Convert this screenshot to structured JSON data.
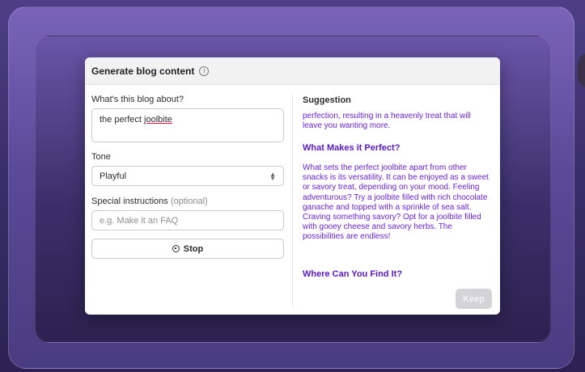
{
  "modal": {
    "title": "Generate blog content",
    "info_icon": "info-icon"
  },
  "form": {
    "topic_label": "What's this blog about?",
    "topic_value_plain": "the perfect ",
    "topic_value_underlined": "joolbite",
    "tone_label": "Tone",
    "tone_value": "Playful",
    "instructions_label": "Special instructions",
    "instructions_optional": "(optional)",
    "instructions_placeholder": "e.g. Make it an FAQ",
    "stop_label": "Stop",
    "stop_icon": "stop-circle-icon"
  },
  "suggestion": {
    "label": "Suggestion",
    "intro": "perfection, resulting in a heavenly treat that will leave you wanting more.",
    "heading1": "What Makes it Perfect?",
    "paragraph1": "What sets the perfect joolbite apart from other snacks is its versatility. It can be enjoyed as a sweet or savory treat, depending on your mood. Feeling adventurous? Try a joolbite filled with rich chocolate ganache and topped with a sprinkle of sea salt. Craving something savory? Opt for a joolbite filled with gooey cheese and savory herbs. The possibilities are endless!",
    "heading2": "Where Can You Find It?",
    "keep_label": "Keep"
  },
  "colors": {
    "accent_text": "#6b22d8",
    "background": "#4d3f86"
  }
}
